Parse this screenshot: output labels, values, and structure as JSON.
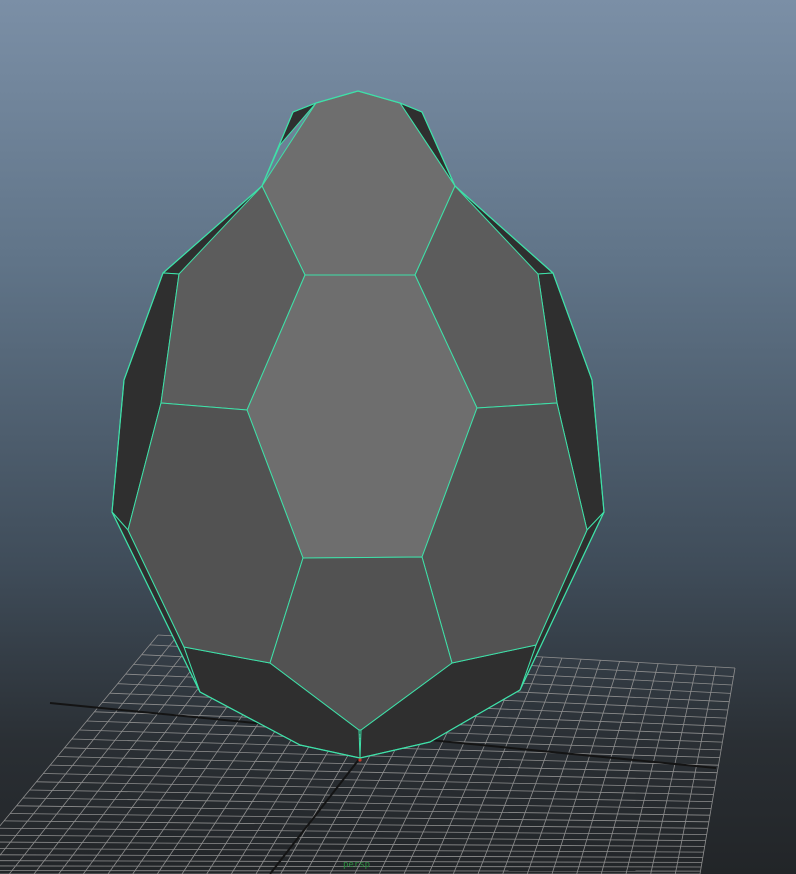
{
  "viewport": {
    "camera_label": "persp",
    "background_top": "#7b8fa6",
    "background_bottom": "#222528"
  },
  "mesh": {
    "object": "polygon-egg",
    "wireframe_color": "#3fe0a8",
    "face_colors": {
      "front_light": "#6e6e6e",
      "side": "#5c5c5c",
      "lower": "#525252",
      "silhouette": "#2f2f2f"
    }
  },
  "grid": {
    "line_color": "#8e8e8e",
    "axis_color": "#141414"
  }
}
